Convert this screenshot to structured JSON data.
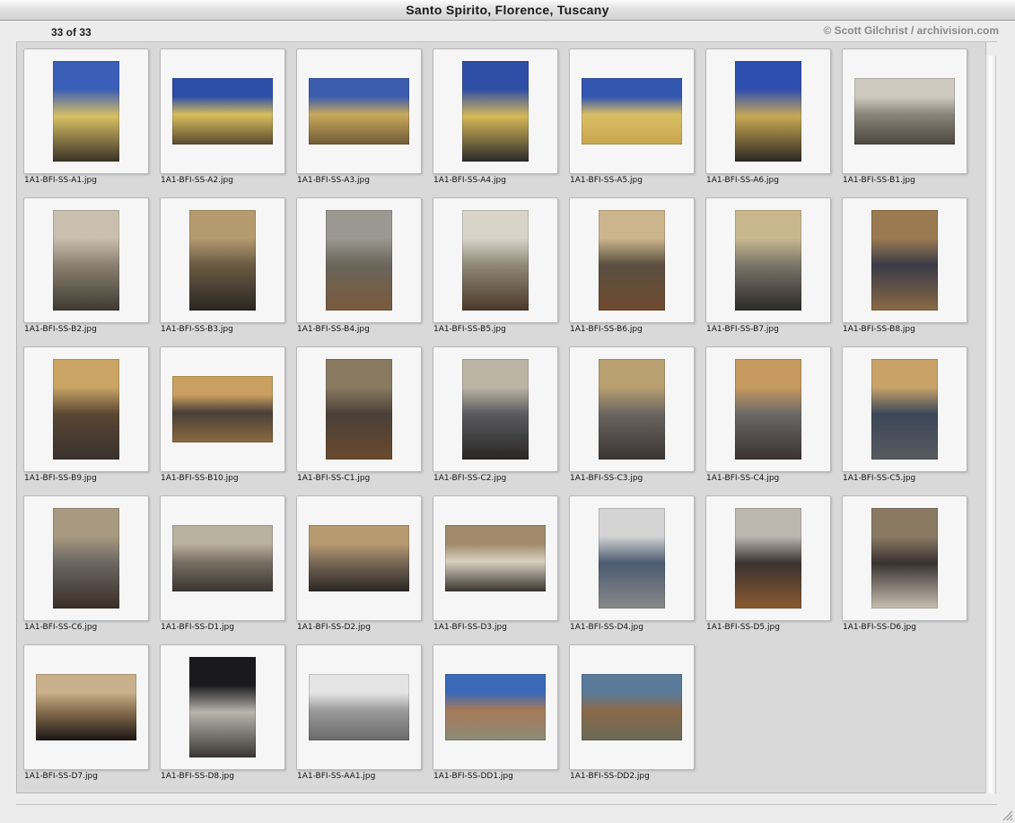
{
  "window": {
    "title": "Santo Spirito, Florence, Tuscany"
  },
  "header": {
    "count": "33 of 33",
    "copyright": "© Scott Gilchrist / archivision.com"
  },
  "items": [
    {
      "filename": "1A1-BFI-SS-A1.jpg",
      "orient": "portrait",
      "colors": [
        "#3a5eb8",
        "#d8c063",
        "#3a3228"
      ]
    },
    {
      "filename": "1A1-BFI-SS-A2.jpg",
      "orient": "landscape",
      "colors": [
        "#2d4fa8",
        "#d9bd5c",
        "#5a4a30"
      ]
    },
    {
      "filename": "1A1-BFI-SS-A3.jpg",
      "orient": "landscape",
      "colors": [
        "#3c5cae",
        "#caa95b",
        "#6e5a36"
      ]
    },
    {
      "filename": "1A1-BFI-SS-A4.jpg",
      "orient": "portrait",
      "colors": [
        "#2e4ea6",
        "#d7b858",
        "#2a2a2a"
      ]
    },
    {
      "filename": "1A1-BFI-SS-A5.jpg",
      "orient": "landscape",
      "colors": [
        "#3356b0",
        "#d9be63",
        "#c8a651"
      ]
    },
    {
      "filename": "1A1-BFI-SS-A6.jpg",
      "orient": "portrait",
      "colors": [
        "#2f4fb0",
        "#c9a955",
        "#2b2620"
      ]
    },
    {
      "filename": "1A1-BFI-SS-B1.jpg",
      "orient": "landscape",
      "colors": [
        "#cfcac0",
        "#8a8478",
        "#4a463e"
      ]
    },
    {
      "filename": "1A1-BFI-SS-B2.jpg",
      "orient": "portrait",
      "colors": [
        "#c8bfae",
        "#8b8070",
        "#3e3a32"
      ]
    },
    {
      "filename": "1A1-BFI-SS-B3.jpg",
      "orient": "portrait",
      "colors": [
        "#b59a70",
        "#6a5a44",
        "#2b2622"
      ]
    },
    {
      "filename": "1A1-BFI-SS-B4.jpg",
      "orient": "portrait",
      "colors": [
        "#9a9890",
        "#6a645a",
        "#7a5a3e"
      ]
    },
    {
      "filename": "1A1-BFI-SS-B5.jpg",
      "orient": "portrait",
      "colors": [
        "#d8d4c8",
        "#908878",
        "#4a3828"
      ]
    },
    {
      "filename": "1A1-BFI-SS-B6.jpg",
      "orient": "portrait",
      "colors": [
        "#cbb58c",
        "#5a4e40",
        "#6e4a2e"
      ]
    },
    {
      "filename": "1A1-BFI-SS-B7.jpg",
      "orient": "portrait",
      "colors": [
        "#c9b88e",
        "#7a7468",
        "#2a2a28"
      ]
    },
    {
      "filename": "1A1-BFI-SS-B8.jpg",
      "orient": "portrait",
      "colors": [
        "#9a7a50",
        "#3a3a48",
        "#8a6a44"
      ]
    },
    {
      "filename": "1A1-BFI-SS-B9.jpg",
      "orient": "portrait",
      "colors": [
        "#c9a465",
        "#5a4632",
        "#3a3230"
      ]
    },
    {
      "filename": "1A1-BFI-SS-B10.jpg",
      "orient": "landscape",
      "colors": [
        "#c9a060",
        "#4a4038",
        "#8a6a40"
      ]
    },
    {
      "filename": "1A1-BFI-SS-C1.jpg",
      "orient": "portrait",
      "colors": [
        "#8a7a62",
        "#4a4038",
        "#6a4a30"
      ]
    },
    {
      "filename": "1A1-BFI-SS-C2.jpg",
      "orient": "portrait",
      "colors": [
        "#bcb4a4",
        "#5a5a5e",
        "#2a2826"
      ]
    },
    {
      "filename": "1A1-BFI-SS-C3.jpg",
      "orient": "portrait",
      "colors": [
        "#b8a070",
        "#6a6460",
        "#3a3634"
      ]
    },
    {
      "filename": "1A1-BFI-SS-C4.jpg",
      "orient": "portrait",
      "colors": [
        "#c69a60",
        "#6a6866",
        "#3a3232"
      ]
    },
    {
      "filename": "1A1-BFI-SS-C5.jpg",
      "orient": "portrait",
      "colors": [
        "#c8a268",
        "#3a4658",
        "#5a5a60"
      ]
    },
    {
      "filename": "1A1-BFI-SS-C6.jpg",
      "orient": "portrait",
      "colors": [
        "#a89a80",
        "#6a6662",
        "#3a2e26"
      ]
    },
    {
      "filename": "1A1-BFI-SS-D1.jpg",
      "orient": "landscape",
      "colors": [
        "#b8b0a0",
        "#7a7064",
        "#3a3430"
      ]
    },
    {
      "filename": "1A1-BFI-SS-D2.jpg",
      "orient": "landscape",
      "colors": [
        "#b89a70",
        "#7a6a58",
        "#2a2622"
      ]
    },
    {
      "filename": "1A1-BFI-SS-D3.jpg",
      "orient": "landscape",
      "colors": [
        "#a08a6a",
        "#d8d0c0",
        "#3a3430"
      ]
    },
    {
      "filename": "1A1-BFI-SS-D4.jpg",
      "orient": "portrait",
      "colors": [
        "#d4d4d4",
        "#4a5a70",
        "#8a8a8a"
      ]
    },
    {
      "filename": "1A1-BFI-SS-D5.jpg",
      "orient": "portrait",
      "colors": [
        "#bcb8b0",
        "#3a3230",
        "#8a5a30"
      ]
    },
    {
      "filename": "1A1-BFI-SS-D6.jpg",
      "orient": "portrait",
      "colors": [
        "#8a7a64",
        "#3a3230",
        "#c8c0b0"
      ]
    },
    {
      "filename": "1A1-BFI-SS-D7.jpg",
      "orient": "landscape",
      "colors": [
        "#c8b08a",
        "#8a7050",
        "#1a1614"
      ]
    },
    {
      "filename": "1A1-BFI-SS-D8.jpg",
      "orient": "portrait",
      "colors": [
        "#1a1a1e",
        "#b8b4ac",
        "#3a3634"
      ]
    },
    {
      "filename": "1A1-BFI-SS-AA1.jpg",
      "orient": "landscape",
      "colors": [
        "#e4e4e4",
        "#9a9a9a",
        "#6a6a6a"
      ]
    },
    {
      "filename": "1A1-BFI-SS-DD1.jpg",
      "orient": "landscape",
      "colors": [
        "#3a6ab8",
        "#a87a58",
        "#8a8a7a"
      ]
    },
    {
      "filename": "1A1-BFI-SS-DD2.jpg",
      "orient": "landscape",
      "colors": [
        "#5a7a9a",
        "#8a6a4a",
        "#6a6a58"
      ]
    }
  ]
}
